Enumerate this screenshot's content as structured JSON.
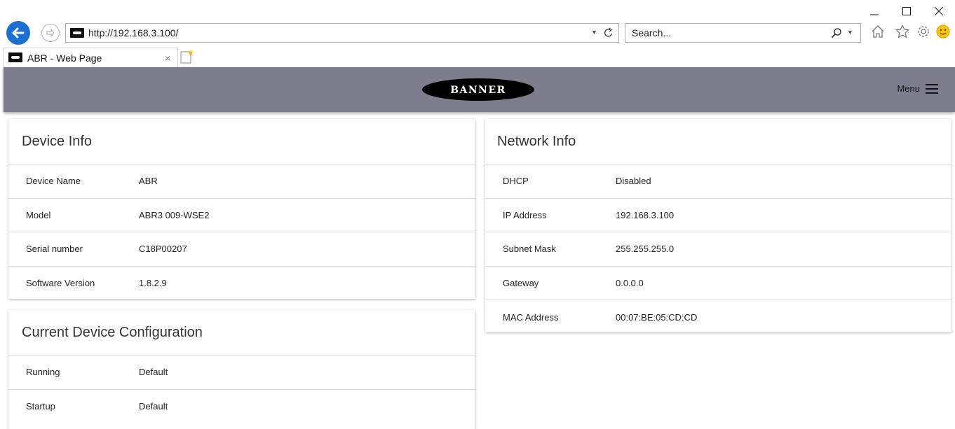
{
  "browser": {
    "url": "http://192.168.3.100/",
    "search_placeholder": "Search...",
    "tab_title": "ABR - Web Page",
    "tab_close": "×"
  },
  "app": {
    "logo_text": "BANNER",
    "menu_label": "Menu"
  },
  "device_info": {
    "title": "Device Info",
    "rows": [
      {
        "label": "Device Name",
        "value": "ABR"
      },
      {
        "label": "Model",
        "value": "ABR3 009-WSE2"
      },
      {
        "label": "Serial number",
        "value": "C18P00207"
      },
      {
        "label": "Software Version",
        "value": "1.8.2.9"
      }
    ]
  },
  "config": {
    "title": "Current Device Configuration",
    "rows": [
      {
        "label": "Running",
        "value": "Default"
      },
      {
        "label": "Startup",
        "value": "Default"
      }
    ]
  },
  "network_info": {
    "title": "Network Info",
    "rows": [
      {
        "label": "DHCP",
        "value": "Disabled"
      },
      {
        "label": "IP Address",
        "value": "192.168.3.100"
      },
      {
        "label": "Subnet Mask",
        "value": "255.255.255.0"
      },
      {
        "label": "Gateway",
        "value": "0.0.0.0"
      },
      {
        "label": "MAC Address",
        "value": "00:07:BE:05:CD:CD"
      }
    ]
  },
  "colors": {
    "header_bg": "#7e7d8e",
    "back_button": "#1e6fd0"
  }
}
